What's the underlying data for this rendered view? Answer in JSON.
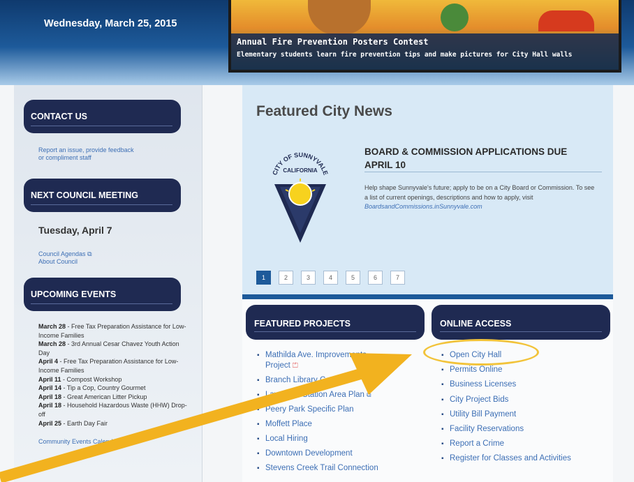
{
  "header": {
    "date": "Wednesday, March 25, 2015"
  },
  "hero": {
    "title": "Annual Fire Prevention Posters Contest",
    "subtitle": "Elementary students learn fire prevention tips and make pictures for City Hall walls"
  },
  "sidebar": {
    "contact": {
      "heading": "CONTACT US",
      "link_line1": "Report an issue, provide feedback",
      "link_line2": "or compliment staff"
    },
    "council": {
      "heading": "NEXT COUNCIL MEETING",
      "date": "Tuesday, April 7",
      "links": [
        "Council Agendas",
        "About Council"
      ]
    },
    "events": {
      "heading": "UPCOMING EVENTS",
      "items": [
        {
          "date": "March 28",
          "text": " - Free Tax Preparation Assistance for Low-Income Families"
        },
        {
          "date": "March 28",
          "text": " - 3rd Annual Cesar Chavez Youth Action Day"
        },
        {
          "date": "April 4",
          "text": " - Free Tax Preparation Assistance for Low-Income Families"
        },
        {
          "date": "April 11",
          "text": " - Compost Workshop"
        },
        {
          "date": "April 14",
          "text": " - Tip a Cop, Country Gourmet"
        },
        {
          "date": "April 18",
          "text": " - Great American Litter Pickup"
        },
        {
          "date": "April 18",
          "text": " - Household Hazardous Waste (HHW) Drop-off"
        },
        {
          "date": "April 25",
          "text": " - Earth Day Fair"
        }
      ],
      "calendar_link": "Community Events Calendar »"
    }
  },
  "main": {
    "title": "Featured City News",
    "seal_text": [
      "CITY OF SUNNYVALE",
      "CALIFORNIA"
    ],
    "news": {
      "headline_line1": "BOARD & COMMISSION APPLICATIONS DUE",
      "headline_line2": "APRIL 10",
      "body": "Help shape Sunnyvale's future; apply to be on a City Board or Commission.  To see a list of current openings, descriptions and how to apply, visit ",
      "body_link": "BoardsandCommissions.inSunnyvale.com"
    },
    "pages": [
      "1",
      "2",
      "3",
      "4",
      "5",
      "6",
      "7"
    ],
    "active_page": "1"
  },
  "projects": {
    "heading": "FEATURED PROJECTS",
    "items": [
      "Mathilda Ave. Improvements Project",
      "Branch Library Concept",
      "Lawrence Station Area Plan",
      "Peery Park Specific Plan",
      "Moffett Place",
      "Local Hiring",
      "Downtown Development",
      "Stevens Creek Trail Connection"
    ]
  },
  "online": {
    "heading": "ONLINE ACCESS",
    "items": [
      "Open City Hall",
      "Permits Online",
      "Business Licenses",
      "City Project Bids",
      "Utility Bill Payment",
      "Facility Reservations",
      "Report a Crime",
      "Register for Classes and Activities"
    ]
  },
  "colors": {
    "navy": "#1f2a52",
    "link": "#3d6fb5",
    "accent_blue": "#1d5a9a",
    "highlight": "#f2c33a"
  }
}
